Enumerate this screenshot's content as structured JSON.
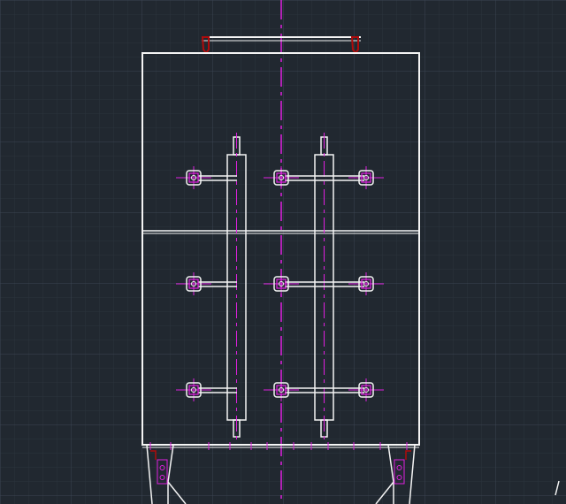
{
  "app": {
    "view": "cad-model-space"
  },
  "canvas": {
    "background_color": "#212830",
    "grid_minor_color": "#2b333d",
    "grid_major_color": "#3a4552",
    "geometry_color": "#f4f4f4",
    "centerline_color": "#e020e0",
    "marker_color": "#b00b0b"
  },
  "drawing": {
    "bolt_rows": 3,
    "bolts_per_row": 4,
    "vertical_members": 2,
    "legs": 2
  },
  "icons": {
    "ucs": "ucs-icon"
  }
}
